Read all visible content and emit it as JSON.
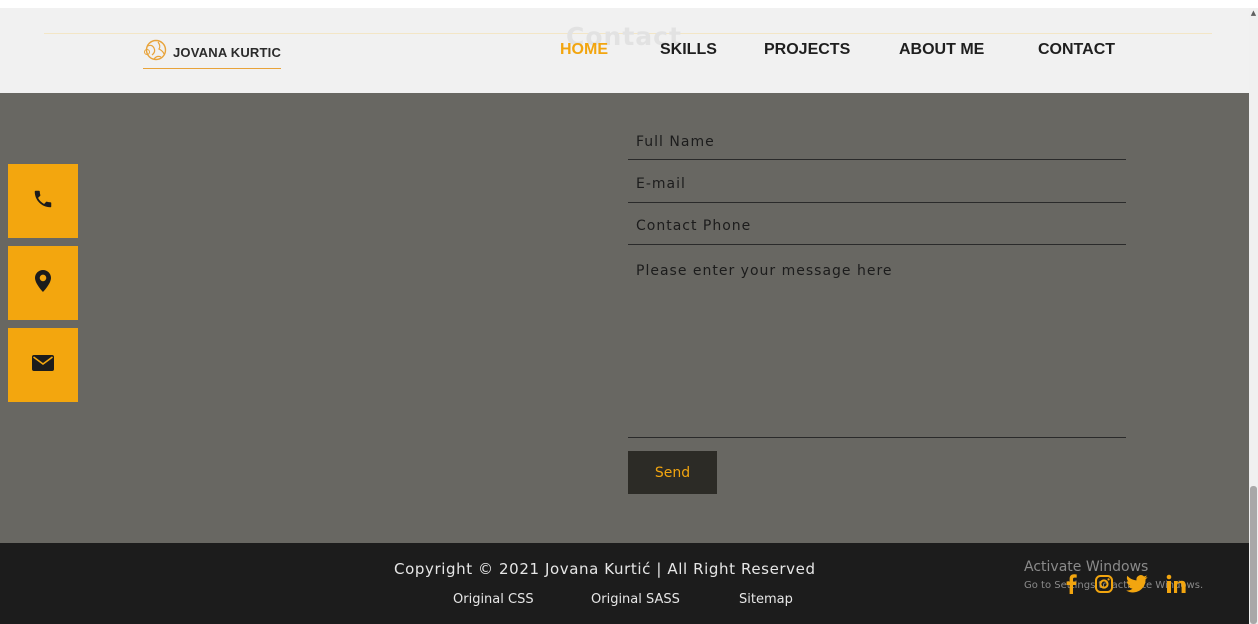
{
  "header": {
    "logo_text": "JOVANA KURTIC",
    "section_title": "Contact",
    "nav": [
      {
        "label": "HOME",
        "active": true
      },
      {
        "label": "SKILLS",
        "active": false
      },
      {
        "label": "PROJECTS",
        "active": false
      },
      {
        "label": "ABOUT ME",
        "active": false
      },
      {
        "label": "CONTACT",
        "active": false
      }
    ]
  },
  "sidebar": {
    "buttons": [
      {
        "icon": "phone-icon"
      },
      {
        "icon": "location-pin-icon"
      },
      {
        "icon": "envelope-icon"
      }
    ]
  },
  "form": {
    "full_name_placeholder": "Full Name",
    "email_placeholder": "E-mail",
    "phone_placeholder": "Contact Phone",
    "message_placeholder": "Please enter your message here",
    "send_label": "Send"
  },
  "footer": {
    "copyright": "Copyright © 2021 Jovana Kurtić | All Right Reserved",
    "links": [
      "Original CSS",
      "Original SASS",
      "Sitemap"
    ],
    "activate_title": "Activate Windows",
    "activate_sub": "Go to Settings to activate Windows.",
    "social": [
      "facebook-icon",
      "instagram-icon",
      "twitter-icon",
      "linkedin-icon"
    ]
  },
  "colors": {
    "accent": "#f2a50f",
    "main_bg": "#686762",
    "footer_bg": "#1c1c1c",
    "header_bg": "#f1f1f1"
  }
}
